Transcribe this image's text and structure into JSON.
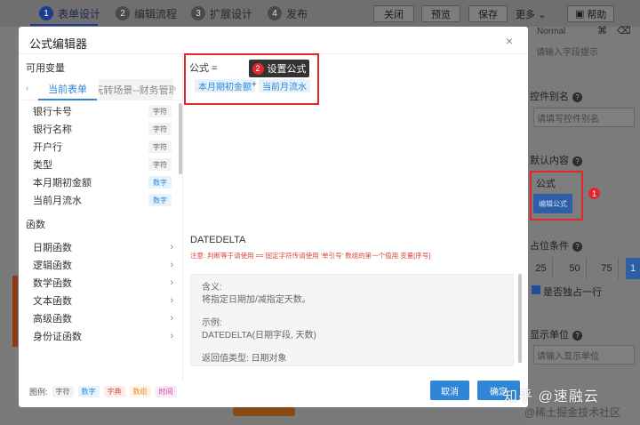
{
  "topbar": {
    "steps": [
      {
        "num": "1",
        "label": "表单设计"
      },
      {
        "num": "2",
        "label": "编辑流程"
      },
      {
        "num": "3",
        "label": "扩展设计"
      },
      {
        "num": "4",
        "label": "发布"
      }
    ],
    "buttons": {
      "close": "关闭",
      "preview": "预览",
      "save": "保存",
      "more": "更多",
      "help": "帮助"
    }
  },
  "right_panel": {
    "normal": "Normal",
    "field_hint_placeholder": "请输入字段提示",
    "alias_label": "控件别名",
    "alias_placeholder": "请填写控件别名",
    "default_label": "默认内容",
    "formula_label": "公式",
    "edit_formula_btn": "编辑公式",
    "badge": "1",
    "width_label": "占位条件",
    "widths": [
      "25",
      "50",
      "75",
      "1"
    ],
    "own_line": "是否独占一行",
    "unit_label": "显示单位",
    "unit_placeholder": "请输入显示单位"
  },
  "modal": {
    "title": "公式编辑器",
    "close": "×",
    "vars_label": "可用变量",
    "tabs": {
      "left_arrow": "‹",
      "active": "当前表单",
      "inactive": "玩转场景--财务管理",
      "right_arrow": "›"
    },
    "variables": [
      {
        "name": "银行卡号",
        "type": "字符",
        "kind": "str"
      },
      {
        "name": "银行名称",
        "type": "字符",
        "kind": "str"
      },
      {
        "name": "开户行",
        "type": "字符",
        "kind": "str"
      },
      {
        "name": "类型",
        "type": "字符",
        "kind": "str"
      },
      {
        "name": "本月期初金额",
        "type": "数字",
        "kind": "num"
      },
      {
        "name": "当前月流水",
        "type": "数字",
        "kind": "num"
      }
    ],
    "funcs_label": "函数",
    "functions": [
      "日期函数",
      "逻辑函数",
      "数学函数",
      "文本函数",
      "高级函数",
      "身份证函数"
    ],
    "legend": {
      "label": "图例:",
      "str": "字符",
      "num": "数字",
      "dict": "字典",
      "arr": "数组",
      "time": "时间"
    },
    "formula": {
      "label": "公式 =",
      "token1": "本月期初金额",
      "plus": "+",
      "token2": "当前月流水"
    },
    "tooltip": {
      "badge": "2",
      "text": "设置公式"
    },
    "func_detail": {
      "name": "DATEDELTA",
      "note": "注意: 判断等于请使用 == 固定字符传请使用 '单引号' 数组的第一个值用 变量[序号]",
      "meaning_label": "含义:",
      "meaning": "将指定日期加/减指定天数。",
      "example_label": "示例:",
      "example": "DATEDELTA(日期字段, 天数)",
      "return_label": "返回值类型:",
      "return": "日期对象"
    },
    "buttons": {
      "cancel": "取消",
      "ok": "确定"
    }
  },
  "watermark": {
    "line1": "知乎 @速融云",
    "line2": "@稀土掘金技术社区"
  }
}
